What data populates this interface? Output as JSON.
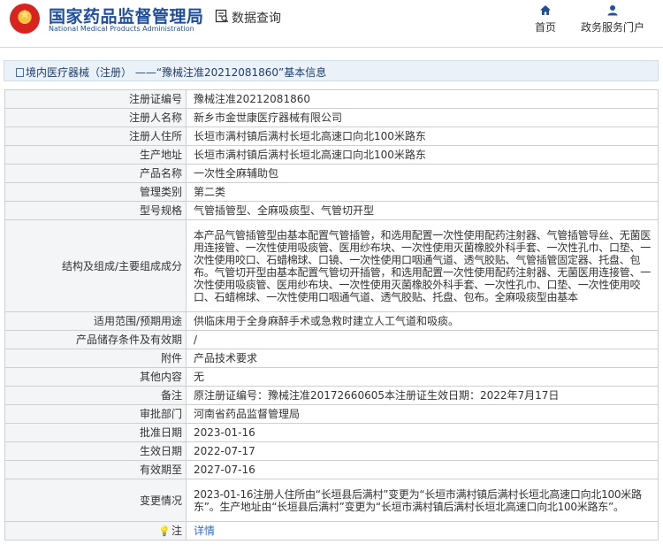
{
  "header": {
    "org_cn": "国家药品监督管理局",
    "org_en": "National Medical Products Administration",
    "data_query": "数据查询",
    "nav": [
      {
        "label": "首页",
        "icon": "home-icon"
      },
      {
        "label": "政务服务门户",
        "icon": "user-icon"
      }
    ],
    "colors": {
      "brand": "#1f4f9a",
      "link": "#2d6ec7",
      "label_bg": "#f4f5f7",
      "breadcrumb_bg": "#eaf1f8"
    }
  },
  "breadcrumb": {
    "text": "境内医疗器械（注册） ——“豫械注准20212081860”基本信息"
  },
  "rows": [
    {
      "label": "注册证编号",
      "value": "豫械注准20212081860"
    },
    {
      "label": "注册人名称",
      "value": "新乡市金世康医疗器械有限公司"
    },
    {
      "label": "注册人住所",
      "value": "长垣市满村镇后满村长垣北高速口向北100米路东"
    },
    {
      "label": "生产地址",
      "value": "长垣市满村镇后满村长垣北高速口向北100米路东"
    },
    {
      "label": "产品名称",
      "value": "一次性全麻辅助包"
    },
    {
      "label": "管理类别",
      "value": "第二类"
    },
    {
      "label": "型号规格",
      "value": "气管插管型、全麻吸痰型、气管切开型"
    },
    {
      "label": "结构及组成/主要组成成分",
      "value": "本产品气管插管型由基本配置气管插管，和选用配置一次性使用配药注射器、气管插管导丝、无菌医用连接管、一次性使用吸痰管、医用纱布块、一次性使用灭菌橡胶外科手套、一次性孔巾、口垫、一次性使用咬口、石蜡棉球、口镜、一次性使用口咽通气道、透气胶贴、气管插管固定器、托盘、包布。气管切开型由基本配置气管切开插管，和选用配置一次性使用配药注射器、无菌医用连接管、一次性使用吸痰管、医用纱布块、一次性使用灭菌橡胶外科手套、一次性孔巾、口垫、一次性使用咬口、石蜡棉球、一次性使用口咽通气道、透气胶贴、托盘、包布。全麻吸痰型由基本"
    },
    {
      "label": "适用范围/预期用途",
      "value": "供临床用于全身麻醉手术或急救时建立人工气道和吸痰。"
    },
    {
      "label": "产品储存条件及有效期",
      "value": "/"
    },
    {
      "label": "附件",
      "value": "产品技术要求"
    },
    {
      "label": "其他内容",
      "value": "无"
    },
    {
      "label": "备注",
      "value": "原注册证编号：豫械注准20172660605本注册证生效日期：2022年7月17日"
    },
    {
      "label": "审批部门",
      "value": "河南省药品监督管理局"
    },
    {
      "label": "批准日期",
      "value": "2023-01-16"
    },
    {
      "label": "生效日期",
      "value": "2022-07-17"
    },
    {
      "label": "有效期至",
      "value": "2027-07-16"
    },
    {
      "label": "变更情况",
      "value": "2023-01-16注册人住所由“长垣县后满村”变更为“长垣市满村镇后满村长垣北高速口向北100米路东”。生产地址由“长垣县后满村”变更为“长垣市满村镇后满村长垣北高速口向北100米路东”。"
    }
  ],
  "note": {
    "label": "注",
    "link": "详情",
    "icon": "lightbulb-icon"
  }
}
